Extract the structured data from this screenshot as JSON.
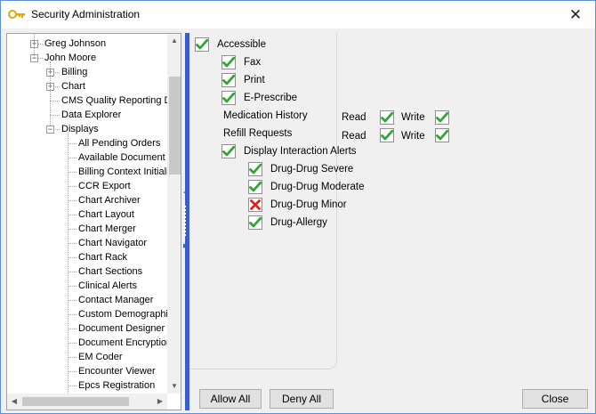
{
  "window": {
    "title": "Security Administration",
    "close_symbol": "✕",
    "icon": "key-icon"
  },
  "tree": {
    "items": [
      {
        "label": "Greg Johnson",
        "state": "collapsed"
      },
      {
        "label": "John Moore",
        "state": "expanded"
      },
      {
        "label": "Billing",
        "state": "collapsed"
      },
      {
        "label": "Chart",
        "state": "collapsed"
      },
      {
        "label": "CMS Quality Reporting D",
        "state": "leaf"
      },
      {
        "label": "Data Explorer",
        "state": "leaf"
      },
      {
        "label": "Displays",
        "state": "expanded"
      },
      {
        "label": "All Pending Orders",
        "state": "leaf"
      },
      {
        "label": "Available Document",
        "state": "leaf"
      },
      {
        "label": "Billing Context Initializ",
        "state": "leaf"
      },
      {
        "label": "CCR Export",
        "state": "leaf"
      },
      {
        "label": "Chart Archiver",
        "state": "leaf"
      },
      {
        "label": "Chart Layout",
        "state": "leaf"
      },
      {
        "label": "Chart Merger",
        "state": "leaf"
      },
      {
        "label": "Chart Navigator",
        "state": "leaf"
      },
      {
        "label": "Chart Rack",
        "state": "leaf"
      },
      {
        "label": "Chart Sections",
        "state": "leaf"
      },
      {
        "label": "Clinical Alerts",
        "state": "leaf"
      },
      {
        "label": "Contact Manager",
        "state": "leaf"
      },
      {
        "label": "Custom Demographic",
        "state": "leaf"
      },
      {
        "label": "Document Designer",
        "state": "leaf"
      },
      {
        "label": "Document Encryption",
        "state": "leaf"
      },
      {
        "label": "EM Coder",
        "state": "leaf"
      },
      {
        "label": "Encounter Viewer",
        "state": "leaf"
      },
      {
        "label": "Epcs Registration",
        "state": "leaf"
      }
    ]
  },
  "permissions": {
    "accessible": {
      "label": "Accessible",
      "state": "allow"
    },
    "fax": {
      "label": "Fax",
      "state": "allow"
    },
    "print": {
      "label": "Print",
      "state": "allow"
    },
    "eprescribe": {
      "label": "E-Prescribe",
      "state": "allow"
    },
    "medication_history": {
      "label": "Medication History",
      "read_label": "Read",
      "read_state": "allow",
      "write_label": "Write",
      "write_state": "allow"
    },
    "refill_requests": {
      "label": "Refill Requests",
      "read_label": "Read",
      "read_state": "allow",
      "write_label": "Write",
      "write_state": "allow"
    },
    "display_interaction_alerts": {
      "label": "Display Interaction Alerts",
      "state": "allow"
    },
    "drug_drug_severe": {
      "label": "Drug-Drug Severe",
      "state": "allow"
    },
    "drug_drug_moderate": {
      "label": "Drug-Drug Moderate",
      "state": "allow"
    },
    "drug_drug_minor": {
      "label": "Drug-Drug Minor",
      "state": "deny"
    },
    "drug_allergy": {
      "label": "Drug-Allergy",
      "state": "allow"
    }
  },
  "buttons": {
    "allow_all": "Allow All",
    "deny_all": "Deny All",
    "close": "Close"
  },
  "colors": {
    "allow_check": "#2fa62f",
    "deny_x": "#e02020",
    "splitter": "#3a5ccc",
    "window_border": "#5b8fd6"
  }
}
